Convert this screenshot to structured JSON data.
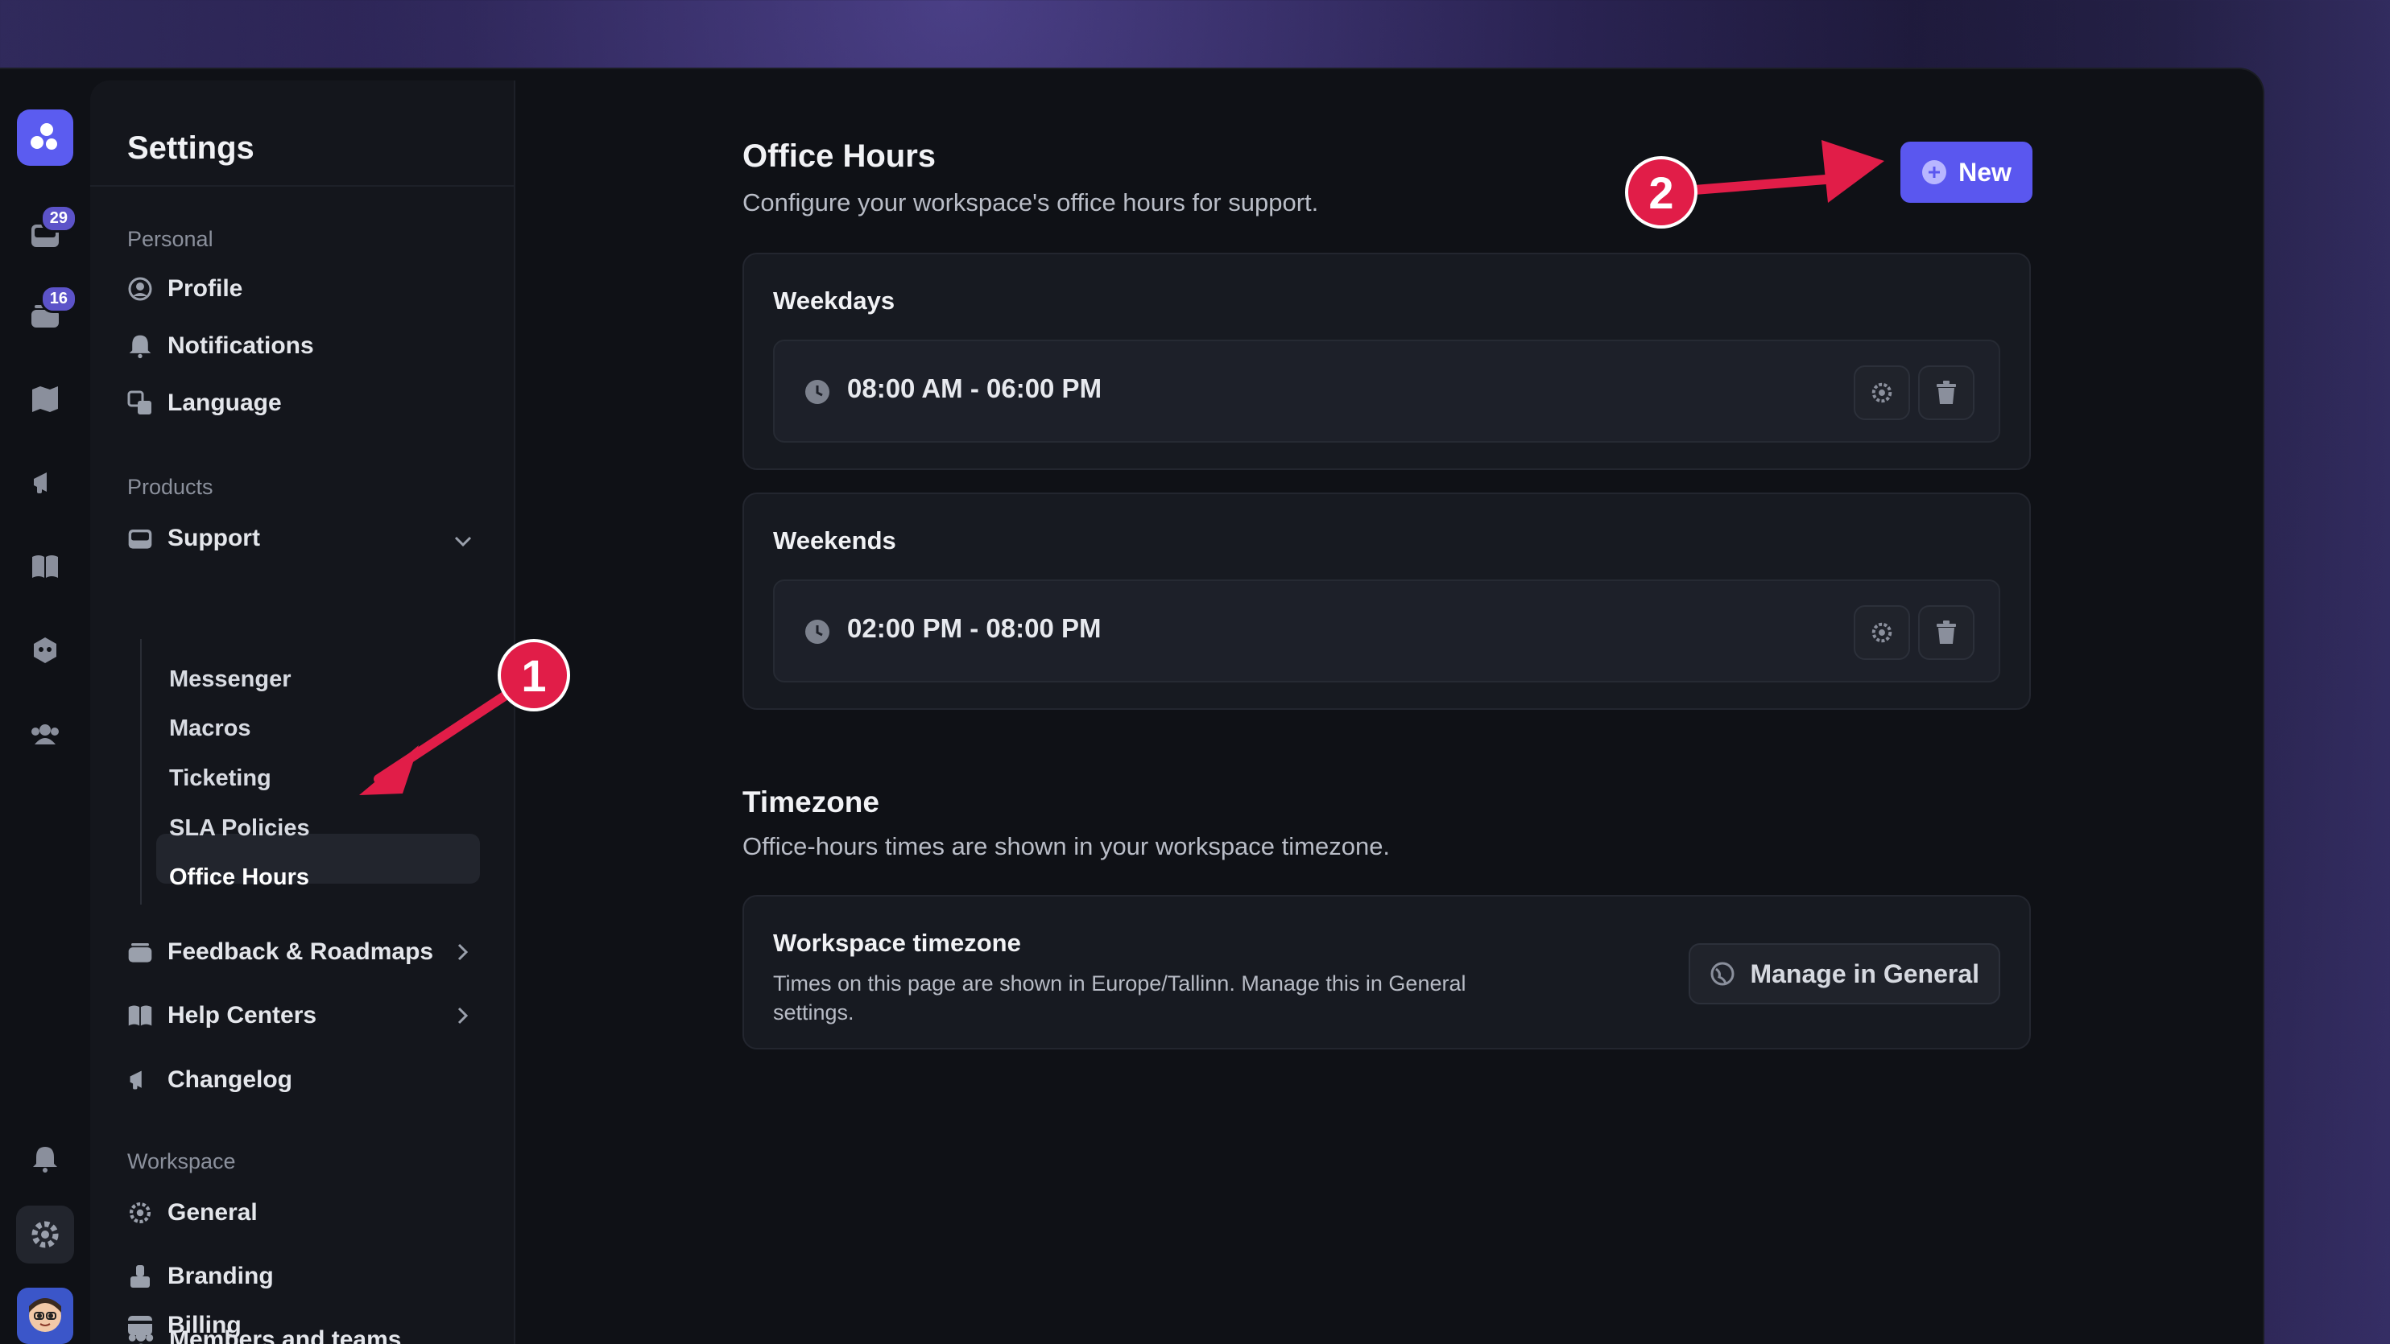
{
  "rail": {
    "badges": [
      "29",
      "16"
    ]
  },
  "sidebar": {
    "title": "Settings",
    "sections": {
      "personal": "Personal",
      "products": "Products",
      "workspace": "Workspace"
    },
    "personal_items": [
      "Profile",
      "Notifications",
      "Language"
    ],
    "support": "Support",
    "support_items": [
      "Messenger",
      "Macros",
      "Ticketing",
      "SLA Policies",
      "Office Hours"
    ],
    "product_items": [
      "Feedback & Roadmaps",
      "Help Centers",
      "Changelog"
    ],
    "workspace_items": [
      "General",
      "Branding",
      "Members and teams",
      "Billing"
    ]
  },
  "main": {
    "title": "Office Hours",
    "subtitle": "Configure your workspace's office hours for support.",
    "new_button": "New",
    "weekdays": {
      "title": "Weekdays",
      "time": "08:00 AM - 06:00 PM"
    },
    "weekends": {
      "title": "Weekends",
      "time": "02:00 PM - 08:00 PM"
    },
    "timezone": {
      "title": "Timezone",
      "subtitle": "Office-hours times are shown in your workspace timezone.",
      "card_title": "Workspace timezone",
      "card_desc": "Times on this page are shown in Europe/Tallinn. Manage this in General settings.",
      "manage_button": "Manage in General"
    }
  },
  "annotations": [
    "1",
    "2"
  ],
  "colors": {
    "accent": "#5a57ef",
    "annotation": "#e11d48"
  }
}
